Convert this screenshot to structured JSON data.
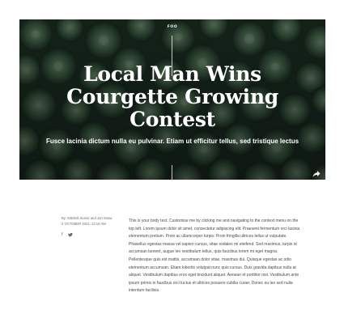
{
  "hero": {
    "category": "FOO",
    "title": "Local Man Wins Courgette Growing Contest",
    "subtitle": "Fusce lacinia dictum nulla eu pulvinar. Etiam ut efficitur tellus, sed tristique lectus",
    "share_icon": "share-arrow-icon"
  },
  "meta": {
    "authors": "By: Mitchell Senior and Jon Snow",
    "date": "2 OCTOBER 2021, 12:15 AM"
  },
  "social": {
    "facebook_label": "f",
    "twitter_label": "♥"
  },
  "article": {
    "body": "This is your body text. Customise me by clicking me and navigating to the context menu on the top left. Lorem ipsum dolor sit amet, consectetur adipiscing elit. Praesent fermentum orci lacinia elementum pretium. Proin ac ullamcorper turpis. Proin fringilla ultrices tellus ut vulputate. Phasellus egestas massa vel sapien cursus, vitae sodales mi eleifend. Sed maximus, turpis id accumsan laoreet, augue leo vestibulum tellus, quis faucibus lorem mi eget magna. Pellentesque quis est mattis, accumsan dolor vitae, maximus dui. Quisque egestas ac odio elementum accumsan. Etiam lobortis volutpat nunc quis cursus. Duis gravida dapibus nulla at aliquet. Vestibulum dapibus eros eget tincidunt aliquet. Aenean et porttitor nisl. Vestibulum ante ipsum primis in faucibus orci luctus et ultrices posuere cubilia curae; Donec eu leo sed nulla interdum facilisis."
  }
}
